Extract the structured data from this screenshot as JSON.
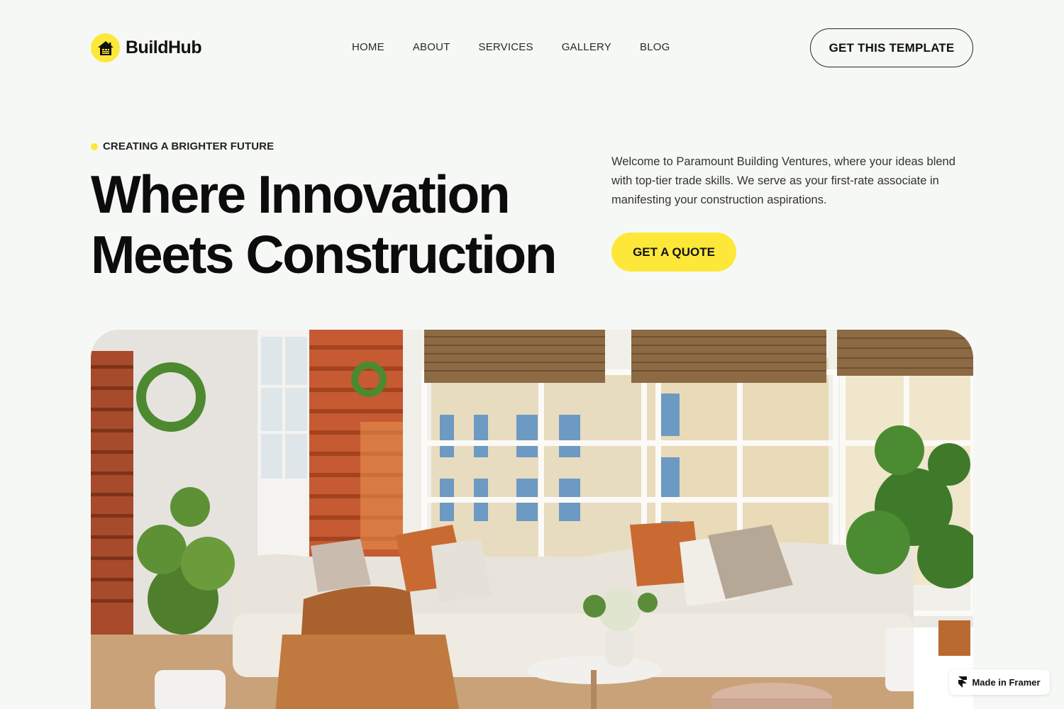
{
  "header": {
    "brand": "BuildHub",
    "nav": [
      "HOME",
      "ABOUT",
      "SERVICES",
      "GALLERY",
      "BLOG"
    ],
    "cta_label": "GET THIS TEMPLATE"
  },
  "hero": {
    "eyebrow": "CREATING A BRIGHTER FUTURE",
    "headline_line1": "Where Innovation",
    "headline_line2": "Meets Construction",
    "intro": "Welcome to Paramount Building Ventures, where your ideas blend with top-tier trade skills. We serve as your first-rate associate in manifesting your construction aspirations.",
    "quote_label": "GET A QUOTE"
  },
  "badge": {
    "label": "Made in Framer"
  },
  "colors": {
    "background": "#f6f8f5",
    "accent": "#fde83a",
    "text": "#111111"
  },
  "icons": {
    "logo": "house-logo-icon",
    "badge": "framer-icon"
  }
}
